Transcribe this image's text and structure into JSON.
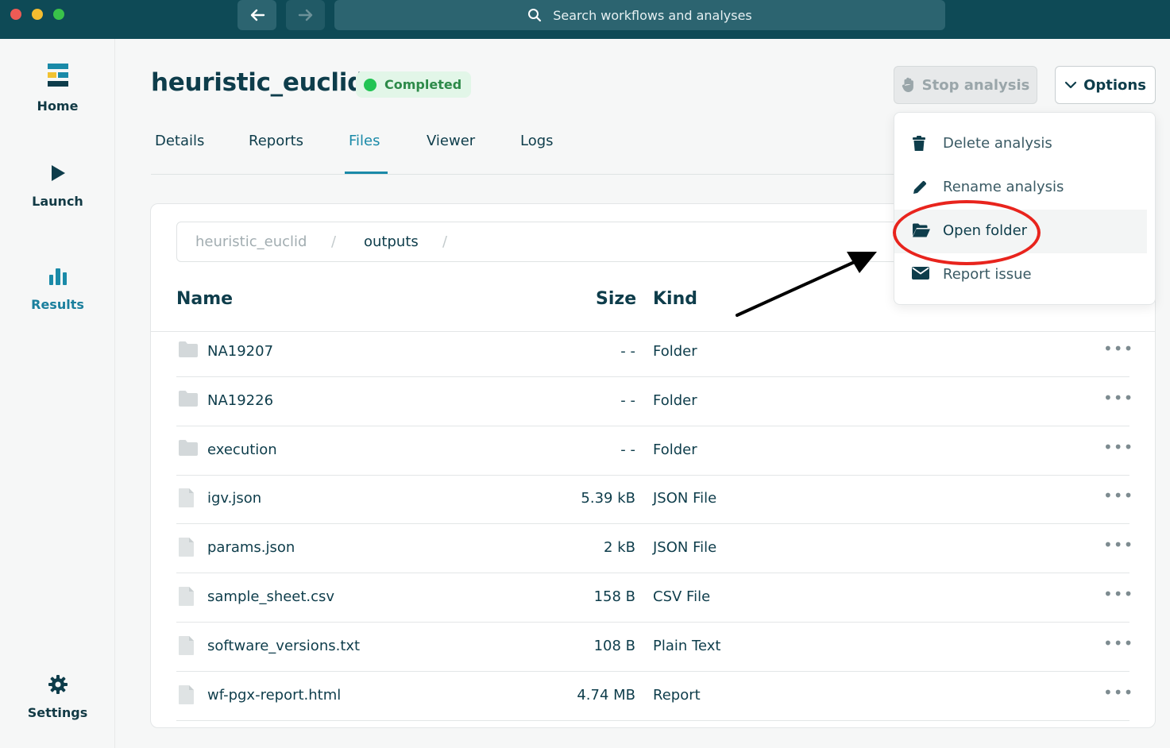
{
  "search": {
    "placeholder": "Search workflows and analyses"
  },
  "sidebar": {
    "items": [
      {
        "label": "Home",
        "icon": "logo-icon"
      },
      {
        "label": "Launch",
        "icon": "play-icon"
      },
      {
        "label": "Results",
        "icon": "bar-chart-icon"
      },
      {
        "label": "Settings",
        "icon": "gear-icon"
      }
    ]
  },
  "analysis": {
    "title": "heuristic_euclid",
    "status": "Completed",
    "stop_label": "Stop analysis",
    "options_label": "Options"
  },
  "tabs": [
    "Details",
    "Reports",
    "Files",
    "Viewer",
    "Logs"
  ],
  "active_tab": "Files",
  "breadcrumb": {
    "root": "heuristic_euclid",
    "separator": "/",
    "current": "outputs"
  },
  "table": {
    "headers": {
      "name": "Name",
      "size": "Size",
      "kind": "Kind"
    },
    "more_glyph": "•••",
    "rows": [
      {
        "name": "NA19207",
        "size": "- -",
        "kind": "Folder",
        "icon": "folder-icon"
      },
      {
        "name": "NA19226",
        "size": "- -",
        "kind": "Folder",
        "icon": "folder-icon"
      },
      {
        "name": "execution",
        "size": "- -",
        "kind": "Folder",
        "icon": "folder-icon"
      },
      {
        "name": "igv.json",
        "size": "5.39 kB",
        "kind": "JSON File",
        "icon": "file-icon"
      },
      {
        "name": "params.json",
        "size": "2 kB",
        "kind": "JSON File",
        "icon": "file-icon"
      },
      {
        "name": "sample_sheet.csv",
        "size": "158 B",
        "kind": "CSV File",
        "icon": "file-icon"
      },
      {
        "name": "software_versions.txt",
        "size": "108 B",
        "kind": "Plain Text",
        "icon": "file-icon"
      },
      {
        "name": "wf-pgx-report.html",
        "size": "4.74 MB",
        "kind": "Report",
        "icon": "file-icon"
      }
    ]
  },
  "menu": {
    "items": [
      {
        "label": "Delete analysis",
        "icon": "trash-icon"
      },
      {
        "label": "Rename analysis",
        "icon": "pencil-icon"
      },
      {
        "label": "Open folder",
        "icon": "folder-open-icon",
        "highlighted": true
      },
      {
        "label": "Report issue",
        "icon": "envelope-icon"
      }
    ]
  },
  "colors": {
    "titlebar": "#0e4a56",
    "accent": "#1a8aa8",
    "status_green": "#22c453",
    "annotation_red": "#e8241d"
  }
}
